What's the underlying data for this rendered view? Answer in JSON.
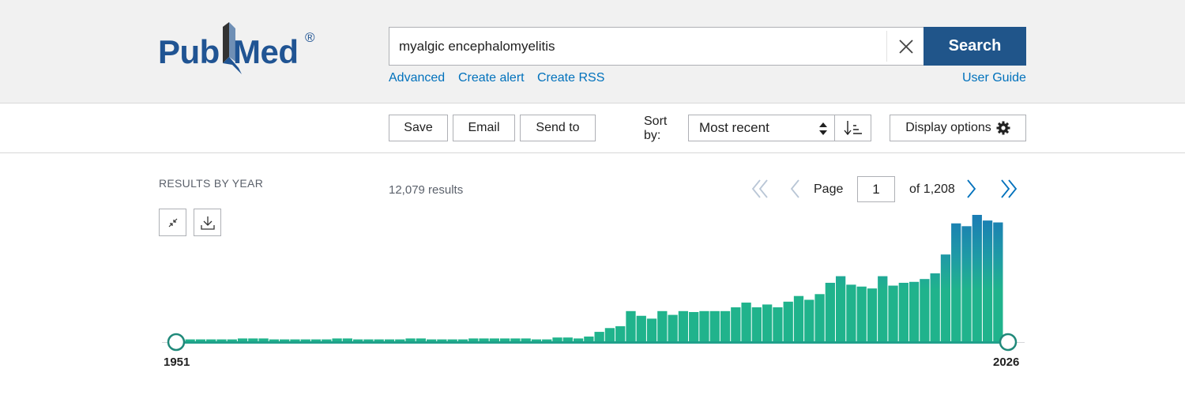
{
  "header": {
    "logo": {
      "pub": "Pub",
      "med": "Med",
      "reg": "®"
    },
    "search": {
      "query": "myalgic encephalomyelitis",
      "button_label": "Search"
    },
    "links": {
      "advanced": "Advanced",
      "create_alert": "Create alert",
      "create_rss": "Create RSS",
      "user_guide": "User Guide"
    }
  },
  "toolbar": {
    "save_label": "Save",
    "email_label": "Email",
    "send_to_label": "Send to",
    "sort_label": "Sort by:",
    "sort_value": "Most recent",
    "display_options_label": "Display options"
  },
  "results": {
    "by_year_label": "RESULTS BY YEAR",
    "count_text": "12,079 results",
    "page_label": "Page",
    "page_value": "1",
    "page_of": "of 1,208"
  },
  "colors": {
    "brand": "#20558a",
    "link": "#0071bc",
    "bar_low": "#20b38c",
    "bar_high": "#1a7bb5"
  },
  "chart_data": {
    "type": "bar",
    "x_start": "1951",
    "x_end": "2026",
    "values": [
      2,
      2,
      2,
      2,
      2,
      3,
      3,
      3,
      2,
      2,
      2,
      2,
      2,
      2,
      3,
      3,
      2,
      2,
      2,
      2,
      2,
      3,
      3,
      2,
      2,
      2,
      2,
      3,
      3,
      3,
      3,
      3,
      3,
      2,
      2,
      4,
      4,
      3,
      5,
      10,
      14,
      16,
      32,
      27,
      24,
      32,
      28,
      32,
      31,
      32,
      32,
      32,
      36,
      41,
      36,
      39,
      36,
      42,
      48,
      44,
      50,
      62,
      69,
      60,
      58,
      56,
      69,
      59,
      62,
      63,
      66,
      72,
      92,
      125,
      122,
      134,
      128,
      126
    ]
  }
}
